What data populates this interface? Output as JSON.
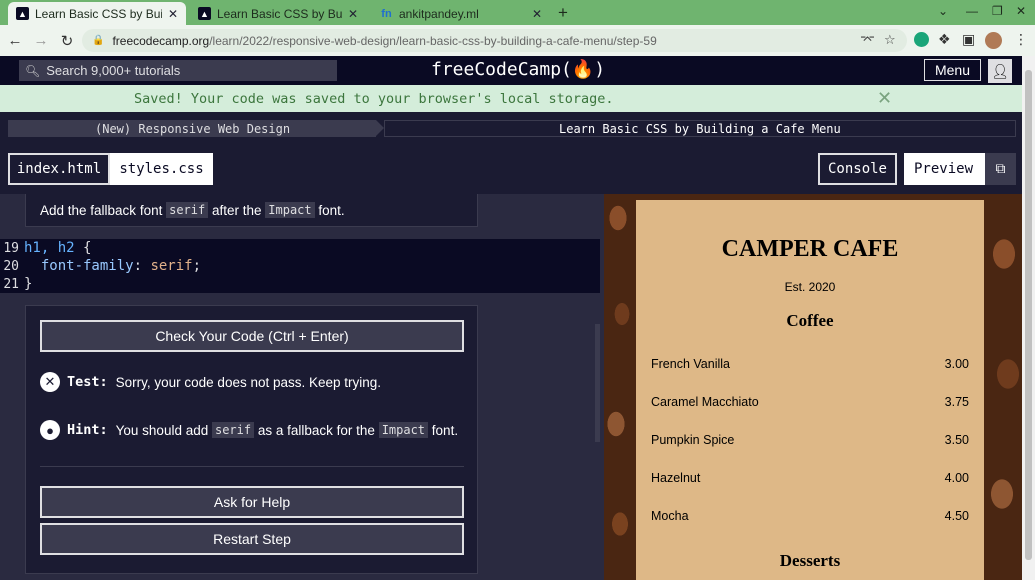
{
  "browser": {
    "tabs": [
      {
        "title": "Learn Basic CSS by Building",
        "active": true
      },
      {
        "title": "Learn Basic CSS by Building",
        "active": false
      },
      {
        "title": "ankitpandey.ml",
        "active": false
      }
    ],
    "url_host": "freecodecamp.org",
    "url_path": "/learn/2022/responsive-web-design/learn-basic-css-by-building-a-cafe-menu/step-59"
  },
  "fcc": {
    "search_placeholder": "Search 9,000+ tutorials",
    "logo": "freeCodeCamp(🔥)",
    "menu_label": "Menu",
    "flash": "Saved! Your code was saved to your browser's local storage.",
    "breadcrumb_cert": "(New) Responsive Web Design",
    "breadcrumb_project": "Learn Basic CSS by Building a Cafe Menu"
  },
  "editor": {
    "file_tabs": [
      "index.html",
      "styles.css"
    ],
    "console_label": "Console",
    "preview_label": "Preview",
    "instruction_pre": "Add the fallback font ",
    "instruction_code1": "serif",
    "instruction_mid": " after the ",
    "instruction_code2": "Impact",
    "instruction_post": " font.",
    "lines": [
      {
        "num": "19",
        "selector": "h1, h2",
        "brace": " {"
      },
      {
        "num": "20",
        "prop": "  font-family",
        "val": "serif"
      },
      {
        "num": "21",
        "text": "}"
      }
    ],
    "check_button": "Check Your Code (Ctrl + Enter)",
    "test_label": "Test:",
    "test_text": "Sorry, your code does not pass. Keep trying.",
    "hint_label": "Hint:",
    "hint_pre": "You should add ",
    "hint_code1": "serif",
    "hint_mid": " as a fallback for the ",
    "hint_code2": "Impact",
    "hint_post": " font.",
    "help_button": "Ask for Help",
    "restart_button": "Restart Step"
  },
  "preview": {
    "title": "CAMPER CAFE",
    "est": "Est. 2020",
    "section1": "Coffee",
    "items": [
      {
        "name": "French Vanilla",
        "price": "3.00"
      },
      {
        "name": "Caramel Macchiato",
        "price": "3.75"
      },
      {
        "name": "Pumpkin Spice",
        "price": "3.50"
      },
      {
        "name": "Hazelnut",
        "price": "4.00"
      },
      {
        "name": "Mocha",
        "price": "4.50"
      }
    ],
    "section2": "Desserts"
  }
}
